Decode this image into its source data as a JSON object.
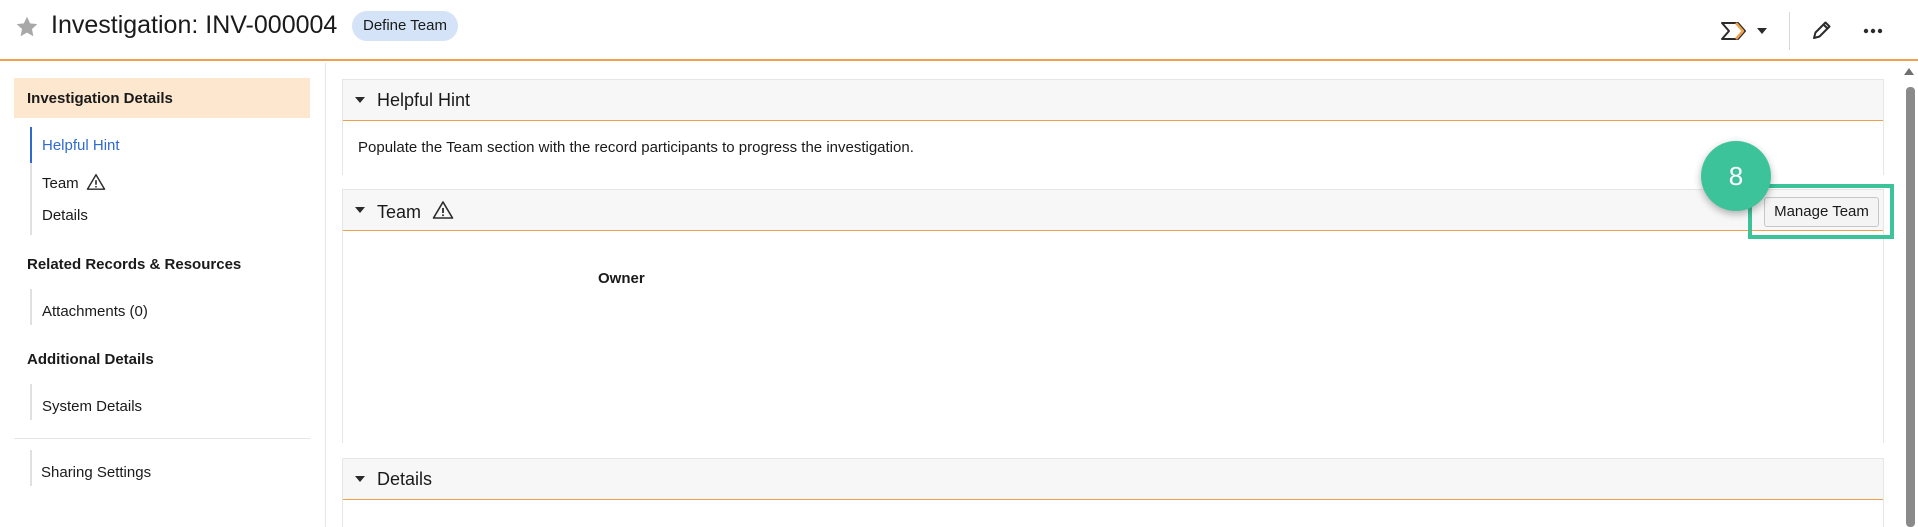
{
  "header": {
    "title": "Investigation: INV-000004",
    "badge": "Define Team"
  },
  "sidebar": {
    "active_section": "Investigation Details",
    "groups": [
      {
        "items": [
          "Helpful Hint",
          "Team",
          "Details"
        ]
      },
      {
        "heading": "Related Records & Resources",
        "items": [
          "Attachments (0)"
        ]
      },
      {
        "heading": "Additional Details",
        "items": [
          "System Details"
        ]
      },
      {
        "items": [
          "Sharing Settings"
        ]
      }
    ]
  },
  "sections": {
    "hint": {
      "title": "Helpful Hint",
      "text": "Populate the Team section with the record participants to progress the investigation."
    },
    "team": {
      "title": "Team",
      "manage_button": "Manage Team",
      "owner_label": "Owner"
    },
    "details": {
      "title": "Details"
    }
  },
  "annotation": {
    "step_number": "8",
    "color": "#3cc39a"
  },
  "colors": {
    "accent_orange": "#f0a04b",
    "link_blue": "#2f6ad0",
    "badge_bg": "#d4e3f7",
    "active_nav_bg": "#fde8cf"
  }
}
